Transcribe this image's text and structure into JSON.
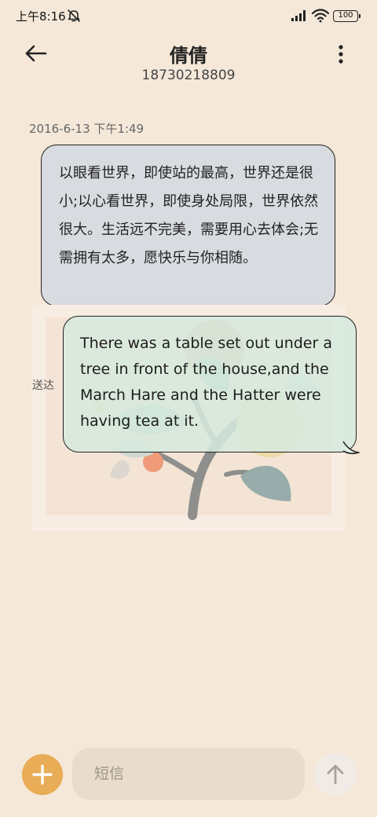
{
  "status_bar": {
    "time": "上午8:16",
    "battery": "100",
    "icons": [
      "mute-icon",
      "signal-icon",
      "wifi-icon",
      "battery-icon"
    ]
  },
  "header": {
    "back_icon": "arrow-left-icon",
    "contact_name": "倩倩",
    "contact_number": "18730218809",
    "more_icon": "more-vertical-icon"
  },
  "conversation": {
    "timestamp": "2016-6-13 下午1:49",
    "messages": [
      {
        "direction": "incoming",
        "text": "以眼看世界，即使站的最高，世界还是很小;以心看世界，即使身处局限，世界依然很大。生活远不完美，需要用心去体会;无需拥有太多，愿快乐与你相随。",
        "bubble_color": "#d8dbe0"
      },
      {
        "direction": "outgoing",
        "text": "There was a table set out under a tree in front of the house,and the March Hare and the Hatter were having tea at it.",
        "status": "送达",
        "bubble_color": "#d6eade"
      }
    ]
  },
  "compose": {
    "add_icon": "plus-icon",
    "placeholder": "短信",
    "send_icon": "arrow-up-icon",
    "accent_color": "#e9ac57"
  },
  "colors": {
    "background": "#f5e8d8",
    "input_background": "#eadccc"
  }
}
